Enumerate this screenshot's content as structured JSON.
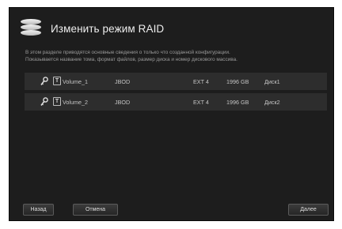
{
  "dialog": {
    "title": "Изменить режим RAID",
    "icon": "database-icon",
    "description": [
      "В этом разделе приводятся основные сведения о только что созданной конфигурации.",
      "Показывается название тома, формат файлов, размер диска и номер дискового массива."
    ]
  },
  "volumes": [
    {
      "name": "Volume_1",
      "raid": "JBOD",
      "fs": "EXT 4",
      "size": "1996 GB",
      "disk": "Диск1",
      "badge": "T"
    },
    {
      "name": "Volume_2",
      "raid": "JBOD",
      "fs": "EXT 4",
      "size": "1996 GB",
      "disk": "Диск2",
      "badge": "T"
    }
  ],
  "buttons": {
    "back": "Назад",
    "cancel": "Отмена",
    "next": "Далее"
  },
  "colors": {
    "dialog_bg": "#1d1d1d",
    "row_bg": "#2d2d2d",
    "text": "#c4c4c4"
  }
}
